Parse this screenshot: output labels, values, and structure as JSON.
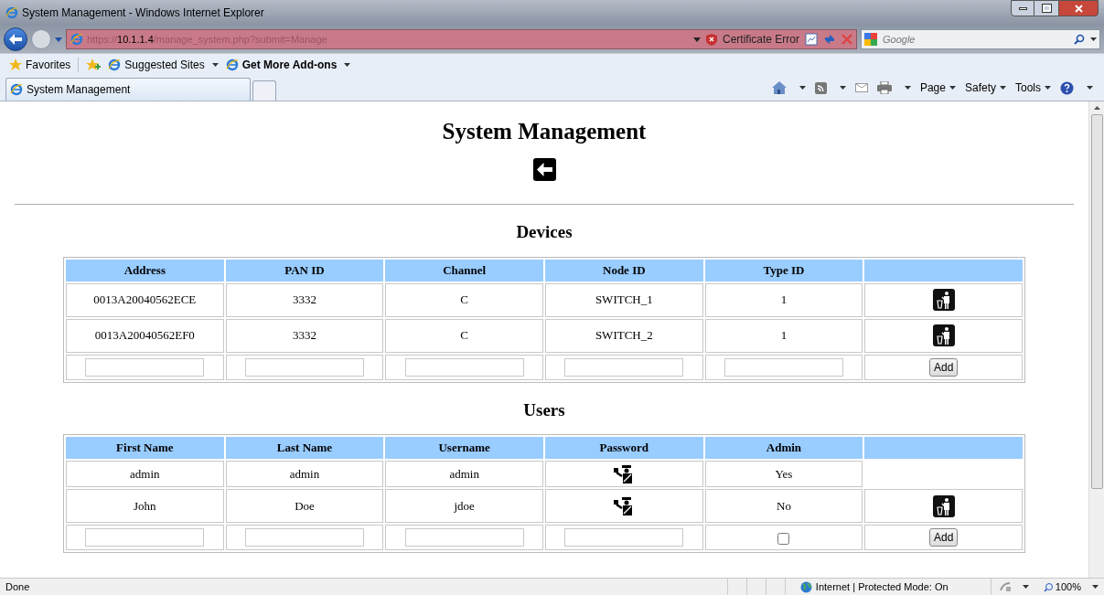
{
  "window": {
    "title": "System Management - Windows Internet Explorer"
  },
  "address_bar": {
    "url_prefix": "https://",
    "url_host": "10.1.1.4",
    "url_path": "/manage_system.php?submit=Manage",
    "certificate_error": "Certificate Error"
  },
  "search": {
    "placeholder": "Google"
  },
  "favorites_bar": {
    "favorites": "Favorites",
    "items": [
      "Suggested Sites",
      "Get More Add-ons"
    ]
  },
  "tabs": [
    {
      "label": "System Management",
      "selected": true
    }
  ],
  "command_bar": [
    "Page",
    "Safety",
    "Tools"
  ],
  "page": {
    "heading": "System Management",
    "sections": [
      {
        "title": "Devices",
        "columns": [
          {
            "label": "Address",
            "kind": "text"
          },
          {
            "label": "PAN ID",
            "kind": "text"
          },
          {
            "label": "Channel",
            "kind": "text"
          },
          {
            "label": "Node ID",
            "kind": "text"
          },
          {
            "label": "Type ID",
            "kind": "text"
          }
        ],
        "rows": [
          {
            "cells": [
              "0013A20040562ECE",
              "3332",
              "C",
              "SWITCH_1",
              "1"
            ],
            "deletable": true
          },
          {
            "cells": [
              "0013A20040562EF0",
              "3332",
              "C",
              "SWITCH_2",
              "1"
            ],
            "deletable": true
          }
        ],
        "new_row": {
          "fields": [
            {
              "kind": "input"
            },
            {
              "kind": "input"
            },
            {
              "kind": "input"
            },
            {
              "kind": "input"
            },
            {
              "kind": "input"
            }
          ],
          "button": "Add"
        }
      },
      {
        "title": "Users",
        "columns": [
          {
            "label": "First Name",
            "kind": "text"
          },
          {
            "label": "Last Name",
            "kind": "text"
          },
          {
            "label": "Username",
            "kind": "text"
          },
          {
            "label": "Password",
            "kind": "password"
          },
          {
            "label": "Admin",
            "kind": "text"
          }
        ],
        "rows": [
          {
            "cells": [
              "admin",
              "admin",
              "admin",
              "Yes"
            ],
            "deletable": false
          },
          {
            "cells": [
              "John",
              "Doe",
              "jdoe",
              "No"
            ],
            "deletable": true
          }
        ],
        "new_row": {
          "fields": [
            {
              "kind": "input"
            },
            {
              "kind": "input"
            },
            {
              "kind": "input"
            },
            {
              "kind": "input"
            },
            {
              "kind": "checkbox",
              "checked": false
            }
          ],
          "button": "Add"
        }
      }
    ]
  },
  "status_bar": {
    "text": "Done",
    "zone": "Internet | Protected Mode: On",
    "zoom": "100%"
  }
}
